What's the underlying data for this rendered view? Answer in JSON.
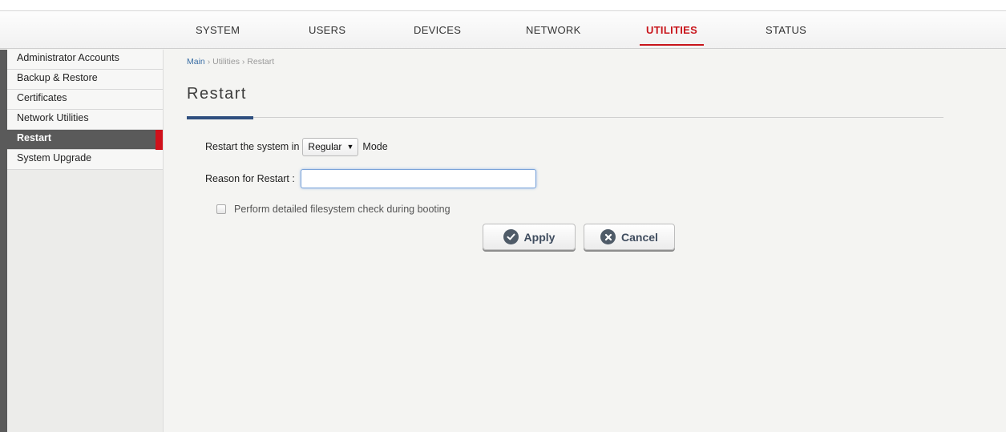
{
  "topnav": {
    "tabs": [
      {
        "label": "SYSTEM",
        "active": false
      },
      {
        "label": "USERS",
        "active": false
      },
      {
        "label": "DEVICES",
        "active": false
      },
      {
        "label": "NETWORK",
        "active": false
      },
      {
        "label": "UTILITIES",
        "active": true
      },
      {
        "label": "STATUS",
        "active": false
      }
    ],
    "active_color": "#c8151b"
  },
  "sidebar": {
    "items": [
      {
        "label": "Administrator Accounts",
        "active": false
      },
      {
        "label": "Backup & Restore",
        "active": false
      },
      {
        "label": "Certificates",
        "active": false
      },
      {
        "label": "Network Utilities",
        "active": false
      },
      {
        "label": "Restart",
        "active": true
      },
      {
        "label": "System Upgrade",
        "active": false
      }
    ]
  },
  "breadcrumb": {
    "main": "Main",
    "separator1": "›",
    "utilities": "Utilities",
    "separator2": "›",
    "current": "Restart"
  },
  "page": {
    "title": "Restart"
  },
  "form": {
    "mode_prefix": "Restart the system in",
    "mode_value": "Regular",
    "mode_suffix": "Mode",
    "reason_label": "Reason for Restart :",
    "reason_value": "",
    "fsck_label": "Perform detailed filesystem check during booting",
    "fsck_checked": false
  },
  "buttons": {
    "apply": "Apply",
    "cancel": "Cancel"
  },
  "icons": {
    "mode_select": "caret-down-icon",
    "apply": "check-circle-icon",
    "cancel": "x-circle-icon"
  }
}
